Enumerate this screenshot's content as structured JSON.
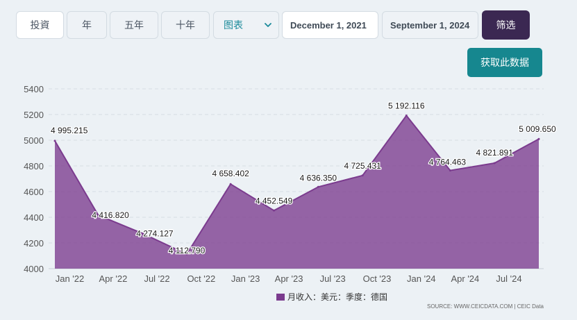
{
  "toolbar": {
    "range_buttons": [
      "投資",
      "年",
      "五年",
      "十年"
    ],
    "view_select": "图表",
    "start_date": "December 1, 2021",
    "end_date": "September 1, 2024",
    "filter_label": "筛选",
    "get_data_label": "获取此数据"
  },
  "colors": {
    "series": "#7b3b8e",
    "filter_button": "#3b2852",
    "get_data_button": "#16878f",
    "select_text": "#1a8a9a"
  },
  "chart_data": {
    "type": "area",
    "x": [
      "2021-12",
      "2022-03",
      "2022-06",
      "2022-09",
      "2022-12",
      "2023-03",
      "2023-06",
      "2023-09",
      "2023-12",
      "2024-03",
      "2024-06",
      "2024-09"
    ],
    "series": [
      {
        "name": "月收入：美元：季度：德国",
        "values": [
          4995.215,
          4416.82,
          4274.127,
          4112.79,
          4658.402,
          4452.549,
          4636.35,
          4725.431,
          5192.116,
          4764.463,
          4821.891,
          5009.65
        ],
        "labels": [
          "4 995.215",
          "4 416.820",
          "4 274.127",
          "4 112.790",
          "4 658.402",
          "4 452.549",
          "4 636.350",
          "4 725.431",
          "5 192.116",
          "4 764.463",
          "4 821.891",
          "5 009.650"
        ]
      }
    ],
    "ylim": [
      4000,
      5400
    ],
    "y_ticks": [
      "4000",
      "4200",
      "4400",
      "4600",
      "4800",
      "5000",
      "5200",
      "5400"
    ],
    "x_ticks": [
      "Jan '22",
      "Apr '22",
      "Jul '22",
      "Oct '22",
      "Jan '23",
      "Apr '23",
      "Jul '23",
      "Oct '23",
      "Jan '24",
      "Apr '24",
      "Jul '24"
    ],
    "grid": true,
    "legend": "bottom-center",
    "source": "SOURCE: WWW.CEICDATA.COM | CEIC Data"
  }
}
